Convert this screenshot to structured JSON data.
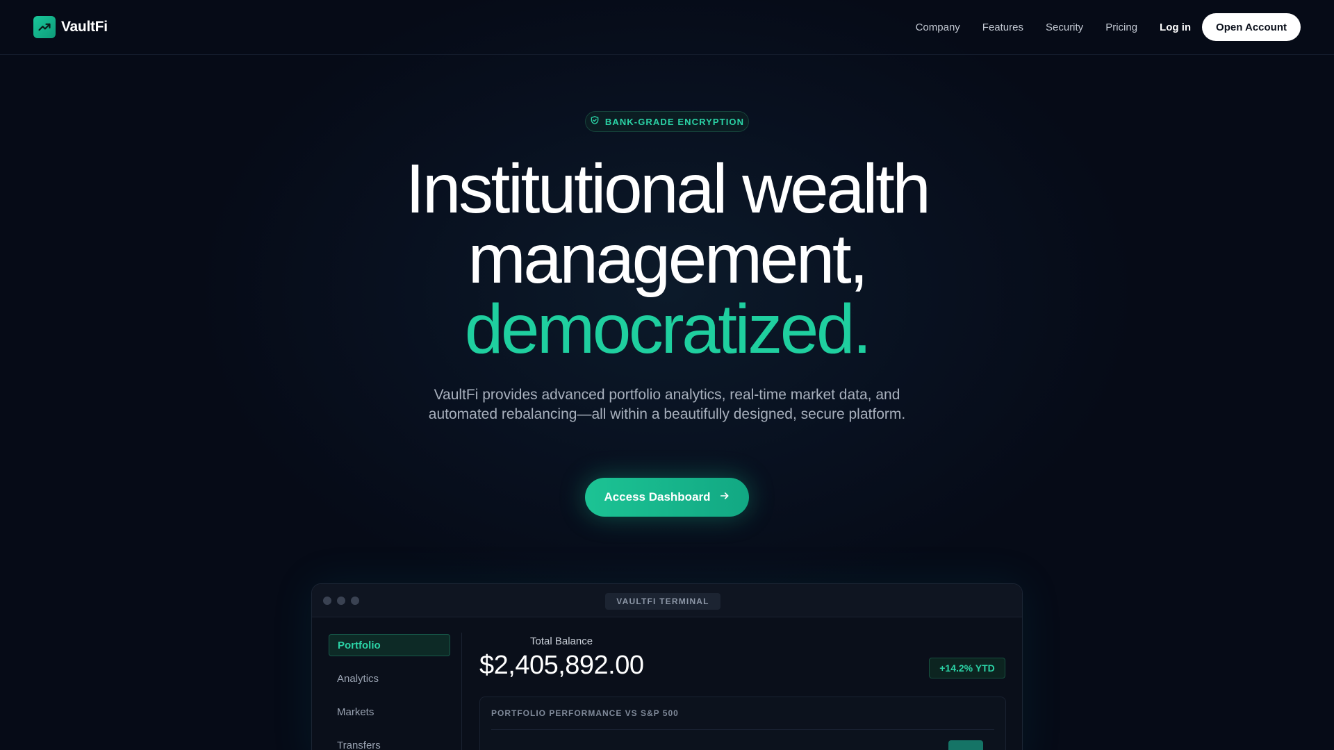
{
  "brand": {
    "name": "VaultFi"
  },
  "nav": {
    "links": [
      "Company",
      "Features",
      "Security",
      "Pricing"
    ],
    "login": "Log in",
    "cta": "Open Account"
  },
  "hero": {
    "badge": "BANK-GRADE ENCRYPTION",
    "headline_line1": "Institutional wealth",
    "headline_line2": "management,",
    "headline_accent": "democratized.",
    "subtitle": "VaultFi provides advanced portfolio analytics, real-time market data, and automated rebalancing—all within a beautifully designed, secure platform.",
    "cta": "Access Dashboard"
  },
  "terminal": {
    "title": "VAULTFI TERMINAL",
    "sidebar": [
      "Portfolio",
      "Analytics",
      "Markets",
      "Transfers"
    ],
    "active_item": "Portfolio",
    "balance_label": "Total Balance",
    "balance_value": "$2,405,892.00",
    "ytd": "+14.2% YTD",
    "chart_title": "PORTFOLIO PERFORMANCE VS S&P 500"
  },
  "colors": {
    "accent": "#1fcf9f",
    "background": "#060b17",
    "cta_white": "#ffffff"
  },
  "icons": {
    "logo": "trending-up-icon",
    "badge": "shield-check-icon",
    "cta": "arrow-right-icon"
  }
}
